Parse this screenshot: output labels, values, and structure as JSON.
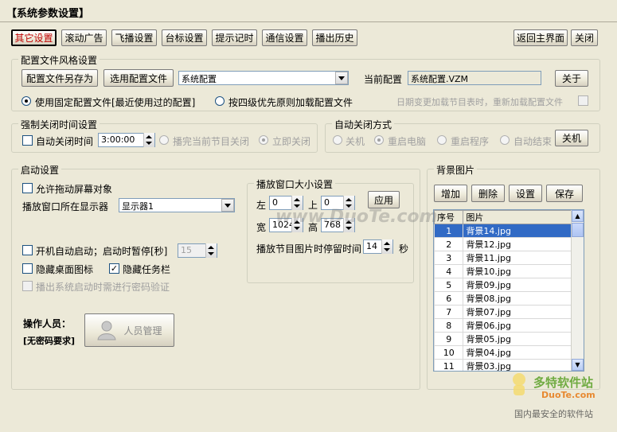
{
  "window": {
    "title": "【系统参数设置】"
  },
  "tabs": [
    {
      "label": "其它设置",
      "selected": true
    },
    {
      "label": "滚动广告"
    },
    {
      "label": "飞播设置"
    },
    {
      "label": "台标设置"
    },
    {
      "label": "提示记时"
    },
    {
      "label": "通信设置"
    },
    {
      "label": "播出历史"
    }
  ],
  "top_buttons": {
    "back": "返回主界面",
    "close": "关闭"
  },
  "config": {
    "legend": "配置文件风格设置",
    "save_as": "配置文件另存为",
    "select": "选用配置文件",
    "combo_value": "系统配置",
    "current_label": "当前配置",
    "current_value": "系统配置.VZM",
    "about": "关于",
    "radio_fixed": "使用固定配置文件[最近使用过的配置]",
    "radio_priority": "按四级优先原则加载配置文件",
    "reload_hint": "日期变更加载节目表时，重新加载配置文件"
  },
  "force_close": {
    "legend": "强制关闭时间设置",
    "auto_close_label": "自动关闭时间",
    "time_value": "3:00:00",
    "after_program": "播完当前节目关闭",
    "immediate": "立即关闭"
  },
  "auto_close_mode": {
    "legend": "自动关闭方式",
    "options": [
      "关机",
      "重启电脑",
      "重启程序",
      "自动结束"
    ],
    "shutdown_button": "关机"
  },
  "startup": {
    "legend": "启动设置",
    "allow_drag": "允许拖动屏幕对象",
    "display_label": "播放窗口所在显示器",
    "display_value": "显示器1",
    "autostart": "开机自动启动；启动时暂停[秒]",
    "pause_seconds": "15",
    "hide_desktop_icons": "隐藏桌面图标",
    "hide_taskbar": "隐藏任务栏",
    "password_verify": "播出系统启动时需进行密码验证",
    "operator_label": "操作人员：",
    "operator_value": "[无密码要求]",
    "staff_button": "人员管理"
  },
  "window_size": {
    "legend": "播放窗口大小设置",
    "left_label": "左",
    "left": "0",
    "top_label": "上",
    "top": "0",
    "width_label": "宽",
    "width": "1024",
    "height_label": "高",
    "height": "768",
    "apply": "应用",
    "stay_label": "播放节目图片时停留时间",
    "stay_value": "14",
    "stay_unit": "秒"
  },
  "background": {
    "legend": "背景图片",
    "buttons": {
      "add": "增加",
      "delete": "删除",
      "settings": "设置",
      "save": "保存"
    },
    "columns": [
      "序号",
      "图片"
    ],
    "rows": [
      [
        "1",
        "背景14.jpg"
      ],
      [
        "2",
        "背景12.jpg"
      ],
      [
        "3",
        "背景11.jpg"
      ],
      [
        "4",
        "背景10.jpg"
      ],
      [
        "5",
        "背景09.jpg"
      ],
      [
        "6",
        "背景08.jpg"
      ],
      [
        "7",
        "背景07.jpg"
      ],
      [
        "8",
        "背景06.jpg"
      ],
      [
        "9",
        "背景05.jpg"
      ],
      [
        "10",
        "背景04.jpg"
      ],
      [
        "11",
        "背景03.jpg"
      ]
    ]
  },
  "watermark": {
    "center": "www.DuoTe.com",
    "logo_text": "多特软件站",
    "logo_site": "DuoTe.com",
    "tagline": "国内最安全的软件站"
  }
}
